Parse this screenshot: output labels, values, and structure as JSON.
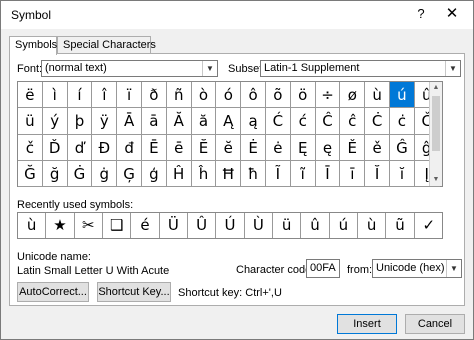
{
  "dialog": {
    "title": "Symbol",
    "help_glyph": "?",
    "close_glyph": "✕"
  },
  "tabs": [
    {
      "label": "Symbols",
      "active": true
    },
    {
      "label": "Special Characters",
      "active": false
    }
  ],
  "font": {
    "label": "Font:",
    "value": "(normal text)"
  },
  "subset": {
    "label": "Subset:",
    "value": "Latin-1 Supplement"
  },
  "symbol_grid": {
    "rows": [
      [
        "ë",
        "ì",
        "í",
        "î",
        "ï",
        "ð",
        "ñ",
        "ò",
        "ó",
        "ô",
        "õ",
        "ö",
        "÷",
        "ø",
        "ù",
        "ú",
        "û"
      ],
      [
        "ü",
        "ý",
        "þ",
        "ÿ",
        "Ā",
        "ā",
        "Ă",
        "ă",
        "Ą",
        "ą",
        "Ć",
        "ć",
        "Ĉ",
        "ĉ",
        "Ċ",
        "ċ",
        "Č"
      ],
      [
        "č",
        "Ď",
        "ď",
        "Đ",
        "đ",
        "Ē",
        "ē",
        "Ĕ",
        "ĕ",
        "Ė",
        "ė",
        "Ę",
        "ę",
        "Ě",
        "ě",
        "Ĝ",
        "ĝ"
      ],
      [
        "Ğ",
        "ğ",
        "Ġ",
        "ġ",
        "Ģ",
        "ģ",
        "Ĥ",
        "ĥ",
        "Ħ",
        "ħ",
        "Ĩ",
        "ĩ",
        "Ī",
        "ī",
        "Ĭ",
        "ĭ",
        "Į"
      ]
    ],
    "selected": "ú"
  },
  "recent": {
    "label": "Recently used symbols:",
    "symbols": [
      "ù",
      "★",
      "✂",
      "❑",
      "é",
      "Ü",
      "Û",
      "Ú",
      "Ù",
      "ü",
      "û",
      "ú",
      "ù",
      "ũ",
      "✓"
    ]
  },
  "unicode_name": {
    "label": "Unicode name:",
    "value": "Latin Small Letter U With Acute"
  },
  "character_code": {
    "label": "Character code:",
    "value": "00FA"
  },
  "from": {
    "label": "from:",
    "value": "Unicode (hex)"
  },
  "buttons": {
    "autocorrect": "AutoCorrect...",
    "shortcut_key": "Shortcut Key...",
    "insert": "Insert",
    "cancel": "Cancel"
  },
  "shortcut_text": "Shortcut key: Ctrl+',U",
  "icons": {
    "dropdown": "chevron-down-icon",
    "scroll_up": "arrow-up-icon",
    "scroll_down": "arrow-down-icon"
  }
}
